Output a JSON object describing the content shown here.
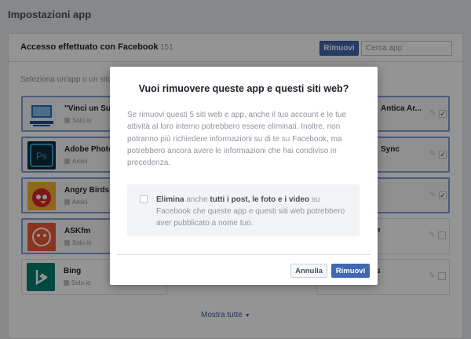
{
  "page": {
    "title": "Impostazioni app"
  },
  "panel": {
    "title": "Accesso effettuato con Facebook",
    "count": "151",
    "remove_label": "Rimuovi",
    "search_placeholder": "Cerca app",
    "hint": "Seleziona un'app o un sito w",
    "show_all": "Mostra tutte"
  },
  "apps_left": [
    {
      "name": "\"Vinci un Sur",
      "sub": "Solo io",
      "selected": true,
      "icon": "vinci-surface-icon",
      "checked": false
    },
    {
      "name": "Adobe Photo",
      "sub": "Amici",
      "selected": true,
      "icon": "photoshop-icon",
      "checked": false
    },
    {
      "name": "Angry Birds R",
      "sub": "Amici",
      "selected": true,
      "icon": "angry-birds-icon",
      "checked": false
    },
    {
      "name": "ASKfm",
      "sub": "Solo io",
      "selected": true,
      "icon": "askfm-icon",
      "checked": false
    },
    {
      "name": "Bing",
      "sub": "Solo io",
      "selected": false,
      "icon": "bing-icon",
      "checked": false
    }
  ],
  "apps_right": [
    {
      "name": "Antica Ar...",
      "selected": true,
      "checked": true
    },
    {
      "name": "Sync",
      "selected": true,
      "checked": true
    },
    {
      "name": "",
      "selected": true,
      "checked": true
    },
    {
      "name": "e",
      "selected": false,
      "checked": false
    },
    {
      "name": "s",
      "selected": false,
      "checked": false
    }
  ],
  "dialog": {
    "title": "Vuoi rimuovere queste app e questi siti web?",
    "body": "Se rimuovi questi 5 siti web e app, anche il tuo account e le tue attività al loro interno potrebbero essere eliminati. Inoltre, non potranno più richiedere informazioni su di te su Facebook, ma potrebbero ancora avere le informazioni che hai condiviso in precedenza.",
    "option_pre": "Elimina",
    "option_mid1": " anche ",
    "option_bold": "tutti i post, le foto e i video",
    "option_post": " su Facebook che queste app e questi siti web potrebbero aver pubblicato a nome tuo.",
    "option_checked": false,
    "cancel_label": "Annulla",
    "confirm_label": "Rimuovi"
  },
  "colors": {
    "accent": "#4267b2",
    "overlay": "rgba(0,0,0,0.42)"
  }
}
